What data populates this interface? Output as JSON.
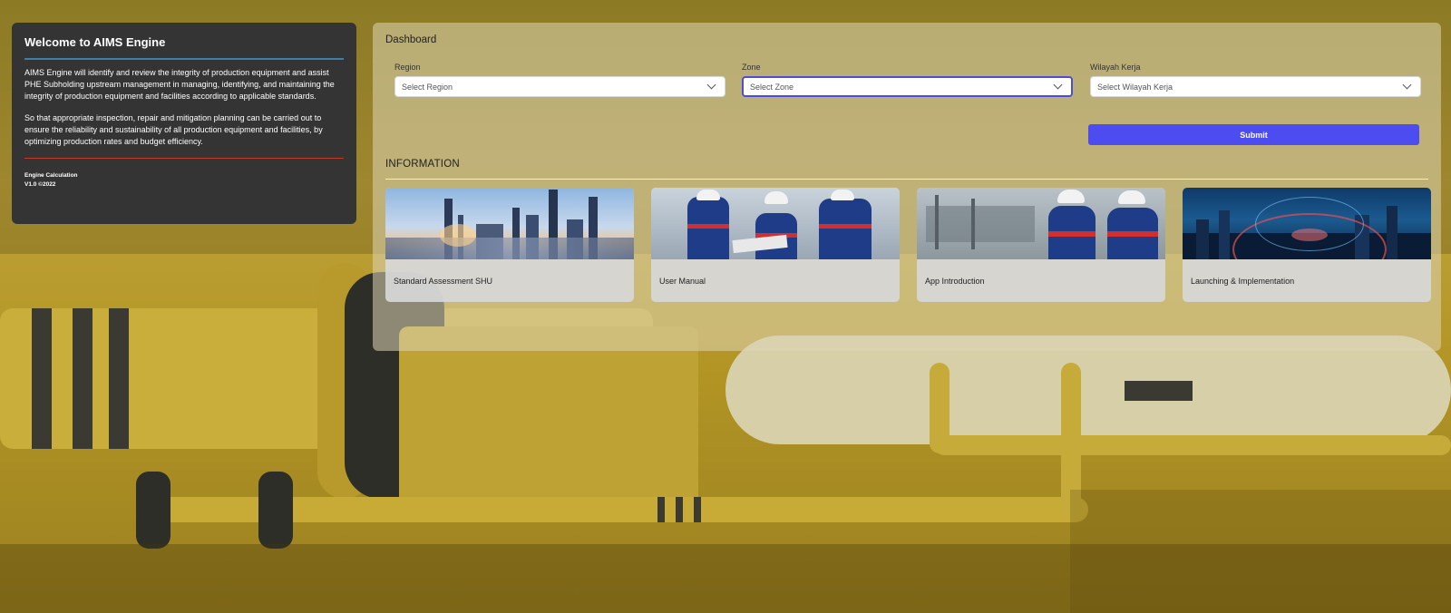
{
  "welcome": {
    "title": "Welcome to AIMS Engine",
    "para1": "AIMS Engine will identify and review the integrity of production equipment and assist PHE Subholding upstream management in managing, identifying, and maintaining the integrity of production equipment and facilities according to applicable standards.",
    "para2": "So that appropriate inspection, repair and mitigation planning can be carried out to ensure the reliability and sustainability of all production equipment and facilities, by optimizing production rates and budget efficiency.",
    "footer_line1": "Engine Calculation",
    "footer_line2": "V1.0 ©2022"
  },
  "dashboard": {
    "title": "Dashboard",
    "filters": [
      {
        "label": "Region",
        "placeholder": "Select Region"
      },
      {
        "label": "Zone",
        "placeholder": "Select Zone"
      },
      {
        "label": "Wilayah Kerja",
        "placeholder": "Select Wilayah Kerja"
      }
    ],
    "submit_label": "Submit",
    "info_title": "INFORMATION",
    "cards": [
      {
        "label": "Standard Assessment SHU",
        "image": "refinery-image"
      },
      {
        "label": "User Manual",
        "image": "workers-image"
      },
      {
        "label": "App Introduction",
        "image": "workers-plant-image"
      },
      {
        "label": "Launching & Implementation",
        "image": "city-network-image"
      }
    ]
  },
  "colors": {
    "accent": "#4c4cf0",
    "welcome_bg": "#343434",
    "blue_rule": "#3d7fa8",
    "red_rule": "#c0392b"
  }
}
